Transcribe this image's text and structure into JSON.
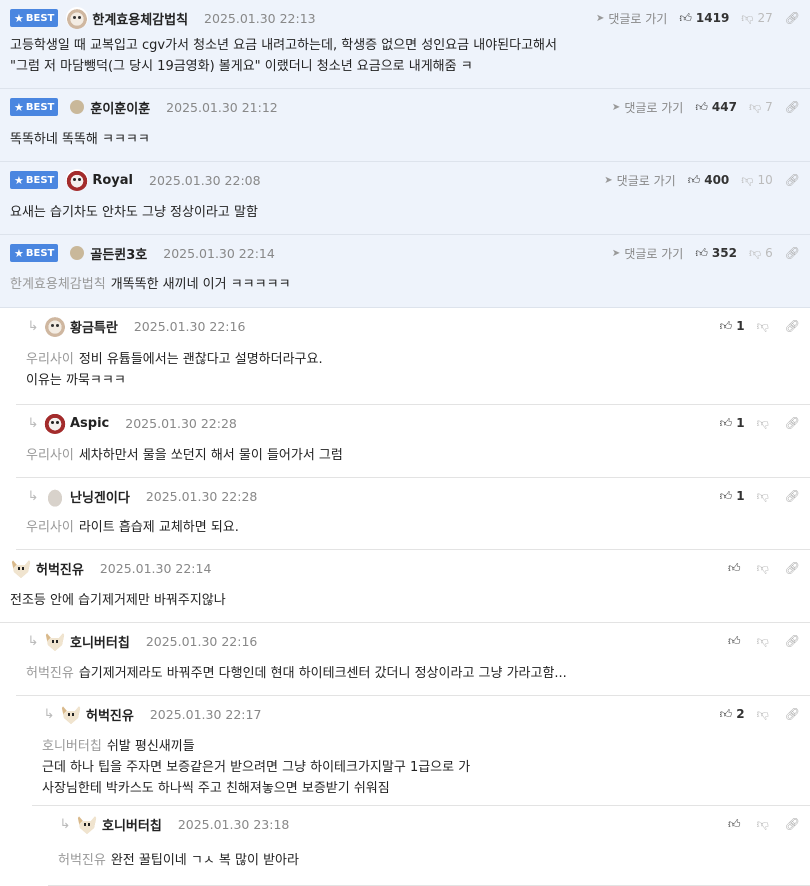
{
  "labels": {
    "best": "BEST",
    "goto_reply": "댓글로 가기"
  },
  "icons": {
    "best": "star-icon",
    "reply_arrow": "reply-arrow-icon",
    "goto": "send-arrow-icon",
    "upvote": "thumbs-up-icon",
    "downvote": "thumbs-down-icon",
    "link": "link-icon"
  },
  "colors": {
    "best_bg": "#eef3fb",
    "badge": "#4a86e0"
  },
  "comments": [
    {
      "best": true,
      "avatar": "dog",
      "nick": "한계효용체감법칙",
      "date": "2025.01.30 22:13",
      "up": "1419",
      "down": "27",
      "lines": [
        "고등학생일 때 교복입고 cgv가서 청소년 요금 내려고하는데, 학생증 없으면 성인요금 내야된다고해서",
        "\"그럼 저 마담뺑덕(그 당시 19금영화) 볼게요\" 이랬더니 청소년 요금으로 내게해줌 ㅋ"
      ]
    },
    {
      "best": true,
      "avatar": "dot",
      "nick": "훈이훈이훈",
      "date": "2025.01.30 21:12",
      "up": "447",
      "down": "7",
      "lines": [
        "똑똑하네 똑똑해 ㅋㅋㅋㅋ"
      ]
    },
    {
      "best": true,
      "avatar": "red",
      "nick": "Royal",
      "date": "2025.01.30 22:08",
      "up": "400",
      "down": "10",
      "lines": [
        "요새는 습기차도 안차도 그냥 정상이라고 말함"
      ]
    },
    {
      "best": true,
      "avatar": "dot",
      "nick": "골든퀸3호",
      "date": "2025.01.30 22:14",
      "up": "352",
      "down": "6",
      "mention": "한계효용체감법칙",
      "lines": [
        "개똑똑한 새끼네 이거 ㅋㅋㅋㅋㅋ"
      ]
    },
    {
      "depth": 1,
      "avatar": "dog",
      "nick": "황금특란",
      "date": "2025.01.30 22:16",
      "up": "1",
      "mention": "우리사이",
      "lines": [
        "정비 유튭들에서는 괜찮다고 설명하더라구요.",
        "이유는 까묵ㅋㅋㅋ"
      ]
    },
    {
      "depth": 1,
      "avatar": "red",
      "nick": "Aspic",
      "date": "2025.01.30 22:28",
      "up": "1",
      "mention": "우리사이",
      "lines": [
        "세차하만서 물을 쏘던지 해서 물이 들어가서 그럼"
      ]
    },
    {
      "depth": 1,
      "avatar": "grey",
      "nick": "난닝겐이다",
      "date": "2025.01.30 22:28",
      "up": "1",
      "mention": "우리사이",
      "lines": [
        "라이트 흡습제 교체하면 되요."
      ]
    },
    {
      "depth": 0,
      "avatar": "fox",
      "nick": "허벅진유",
      "date": "2025.01.30 22:14",
      "up": "",
      "lines": [
        "전조등 안에 습기제거제만 바꿔주지않나"
      ]
    },
    {
      "depth": 1,
      "avatar": "fox",
      "nick": "호니버터칩",
      "date": "2025.01.30 22:16",
      "up": "",
      "mention": "허벅진유",
      "lines": [
        "습기제거제라도 바꿔주면 다행인데 현대 하이테크센터 갔더니 정상이라고 그냥 가라고함..."
      ]
    },
    {
      "depth": 2,
      "avatar": "fox",
      "nick": "허벅진유",
      "date": "2025.01.30 22:17",
      "up": "2",
      "mention": "호니버터칩",
      "lines": [
        "쉬발 평신새끼들",
        "근데 하나 팁을 주자면 보증같은거 받으려면 그냥 하이테크가지말구 1급으로 가",
        "사장님한테 박카스도 하나씩 주고 친해져놓으면 보증받기 쉬워짐"
      ]
    },
    {
      "depth": 3,
      "avatar": "fox",
      "nick": "호니버터칩",
      "date": "2025.01.30 23:18",
      "up": "",
      "mention": "허벅진유",
      "lines": [
        "완전 꿀팁이네 ㄱㅅ 복 많이 받아라"
      ]
    }
  ]
}
